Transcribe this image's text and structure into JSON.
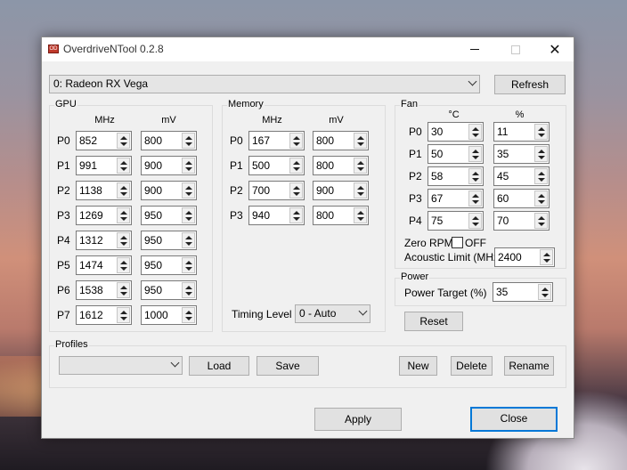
{
  "window": {
    "title": "OverdriveNTool 0.2.8",
    "app_icon": "OD"
  },
  "device": {
    "selected": "0: Radeon RX Vega"
  },
  "buttons": {
    "refresh": "Refresh",
    "reset": "Reset",
    "load": "Load",
    "save": "Save",
    "new": "New",
    "delete": "Delete",
    "rename": "Rename",
    "apply": "Apply",
    "close": "Close"
  },
  "gpu": {
    "title": "GPU",
    "col_mhz": "MHz",
    "col_mv": "mV",
    "rows": [
      {
        "label": "P0",
        "mhz": "852",
        "mv": "800"
      },
      {
        "label": "P1",
        "mhz": "991",
        "mv": "900"
      },
      {
        "label": "P2",
        "mhz": "1138",
        "mv": "900"
      },
      {
        "label": "P3",
        "mhz": "1269",
        "mv": "950"
      },
      {
        "label": "P4",
        "mhz": "1312",
        "mv": "950"
      },
      {
        "label": "P5",
        "mhz": "1474",
        "mv": "950"
      },
      {
        "label": "P6",
        "mhz": "1538",
        "mv": "950"
      },
      {
        "label": "P7",
        "mhz": "1612",
        "mv": "1000"
      }
    ]
  },
  "memory": {
    "title": "Memory",
    "col_mhz": "MHz",
    "col_mv": "mV",
    "rows": [
      {
        "label": "P0",
        "mhz": "167",
        "mv": "800"
      },
      {
        "label": "P1",
        "mhz": "500",
        "mv": "800"
      },
      {
        "label": "P2",
        "mhz": "700",
        "mv": "900"
      },
      {
        "label": "P3",
        "mhz": "940",
        "mv": "800"
      }
    ],
    "timing_label": "Timing Level",
    "timing_value": "0 - Auto"
  },
  "fan": {
    "title": "Fan",
    "col_c": "°C",
    "col_pct": "%",
    "rows": [
      {
        "label": "P0",
        "temp": "30",
        "pct": "11"
      },
      {
        "label": "P1",
        "temp": "50",
        "pct": "35"
      },
      {
        "label": "P2",
        "temp": "58",
        "pct": "45"
      },
      {
        "label": "P3",
        "temp": "67",
        "pct": "60"
      },
      {
        "label": "P4",
        "temp": "75",
        "pct": "70"
      }
    ],
    "zero_rpm_label": "Zero RPM",
    "zero_rpm_state": "OFF",
    "acoustic_label": "Acoustic Limit (MHz)",
    "acoustic_value": "2400"
  },
  "power": {
    "title": "Power",
    "target_label": "Power Target (%)",
    "target_value": "35"
  },
  "profiles": {
    "title": "Profiles",
    "selected": ""
  }
}
